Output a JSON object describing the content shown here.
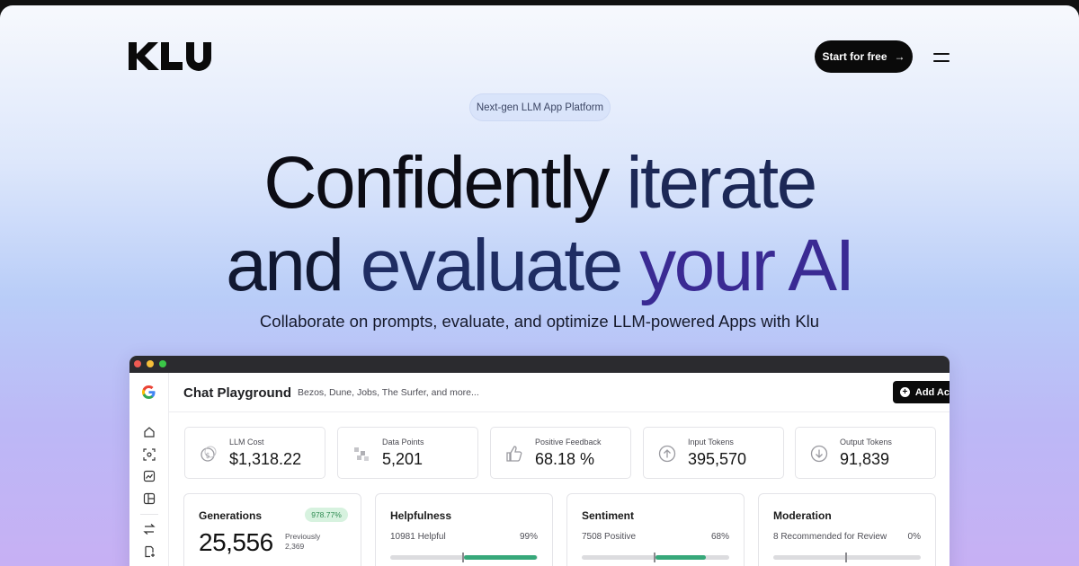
{
  "brand": {
    "name": "KLU"
  },
  "header": {
    "cta_label": "Start for free",
    "cta_arrow": "→"
  },
  "hero": {
    "badge": "Next-gen LLM App Platform",
    "line1_a": "Confidently ",
    "line1_b": "iterate",
    "line2_a": "and ",
    "line2_b": "evaluate ",
    "line2_c": "your AI",
    "subtitle": "Collaborate on prompts, evaluate, and optimize LLM-powered Apps with Klu"
  },
  "app": {
    "title": "Chat Playground",
    "subtitle": "Bezos, Dune, Jobs, The Surfer, and more...",
    "add_action": "Add Action",
    "sidebar_icons": [
      "home-icon",
      "scan-icon",
      "chart-icon",
      "layout-icon",
      "swap-icon",
      "document-plus-icon"
    ],
    "stats": [
      {
        "label": "LLM Cost",
        "value": "$1,318.22",
        "icon": "coin-icon"
      },
      {
        "label": "Data Points",
        "value": "5,201",
        "icon": "data-points-icon"
      },
      {
        "label": "Positive Feedback",
        "value": "68.18 %",
        "icon": "thumbs-up-icon"
      },
      {
        "label": "Input Tokens",
        "value": "395,570",
        "icon": "arrow-up-circle-icon"
      },
      {
        "label": "Output Tokens",
        "value": "91,839",
        "icon": "arrow-down-circle-icon"
      }
    ],
    "generations": {
      "title": "Generations",
      "badge": "978.77%",
      "value": "25,556",
      "previous_label": "Previously",
      "previous_value": "2,369"
    },
    "cards": [
      {
        "title": "Helpfulness",
        "left": "10981 Helpful",
        "right": "99%",
        "fill": 0.99
      },
      {
        "title": "Sentiment",
        "left": "7508 Positive",
        "right": "68%",
        "fill": 0.68
      },
      {
        "title": "Moderation",
        "left": "8 Recommended for Review",
        "right": "0%",
        "fill": 0
      }
    ],
    "colors": {
      "accent_green": "#37a87a",
      "dark": "#0b0b0b"
    }
  }
}
